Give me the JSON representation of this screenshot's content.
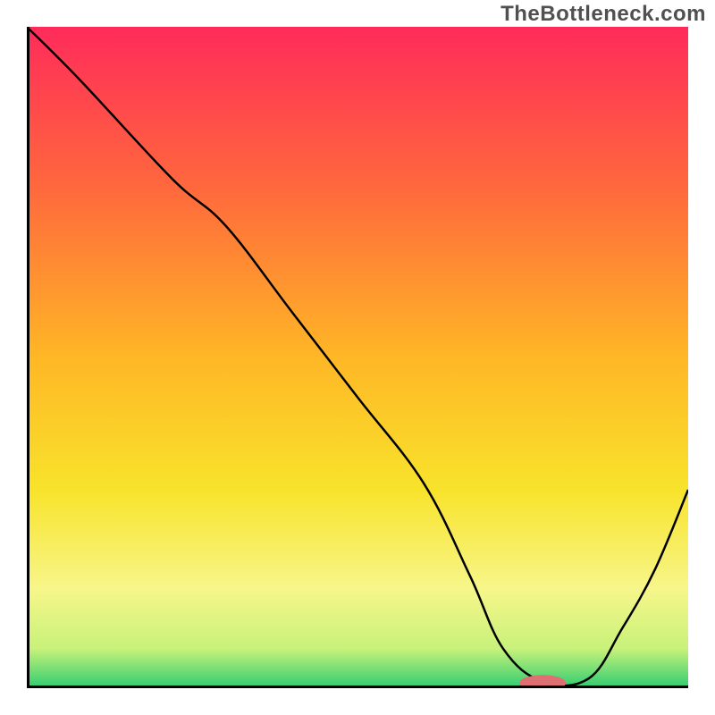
{
  "watermark": "TheBottleneck.com",
  "chart_data": {
    "type": "line",
    "title": "",
    "xlabel": "",
    "ylabel": "",
    "xlim": [
      0,
      100
    ],
    "ylim": [
      0,
      100
    ],
    "series": [
      {
        "name": "curve",
        "x": [
          0,
          8,
          22,
          30,
          40,
          50,
          60,
          67,
          72,
          78,
          85,
          90,
          95,
          100
        ],
        "values": [
          100,
          92,
          77,
          70,
          57,
          44,
          31,
          17,
          6,
          1,
          1.5,
          9,
          18,
          30
        ]
      }
    ],
    "marker": {
      "x": 78,
      "y": 0.8,
      "color": "#de6f72",
      "rx": 3.5,
      "ry": 1.2
    },
    "gradient_stops": [
      {
        "offset": 0,
        "color": "#ff2b5a"
      },
      {
        "offset": 25,
        "color": "#ff6a3c"
      },
      {
        "offset": 50,
        "color": "#ffb726"
      },
      {
        "offset": 70,
        "color": "#f8e32b"
      },
      {
        "offset": 85,
        "color": "#f7f68a"
      },
      {
        "offset": 94,
        "color": "#c8f27a"
      },
      {
        "offset": 100,
        "color": "#2ecc71"
      }
    ]
  }
}
